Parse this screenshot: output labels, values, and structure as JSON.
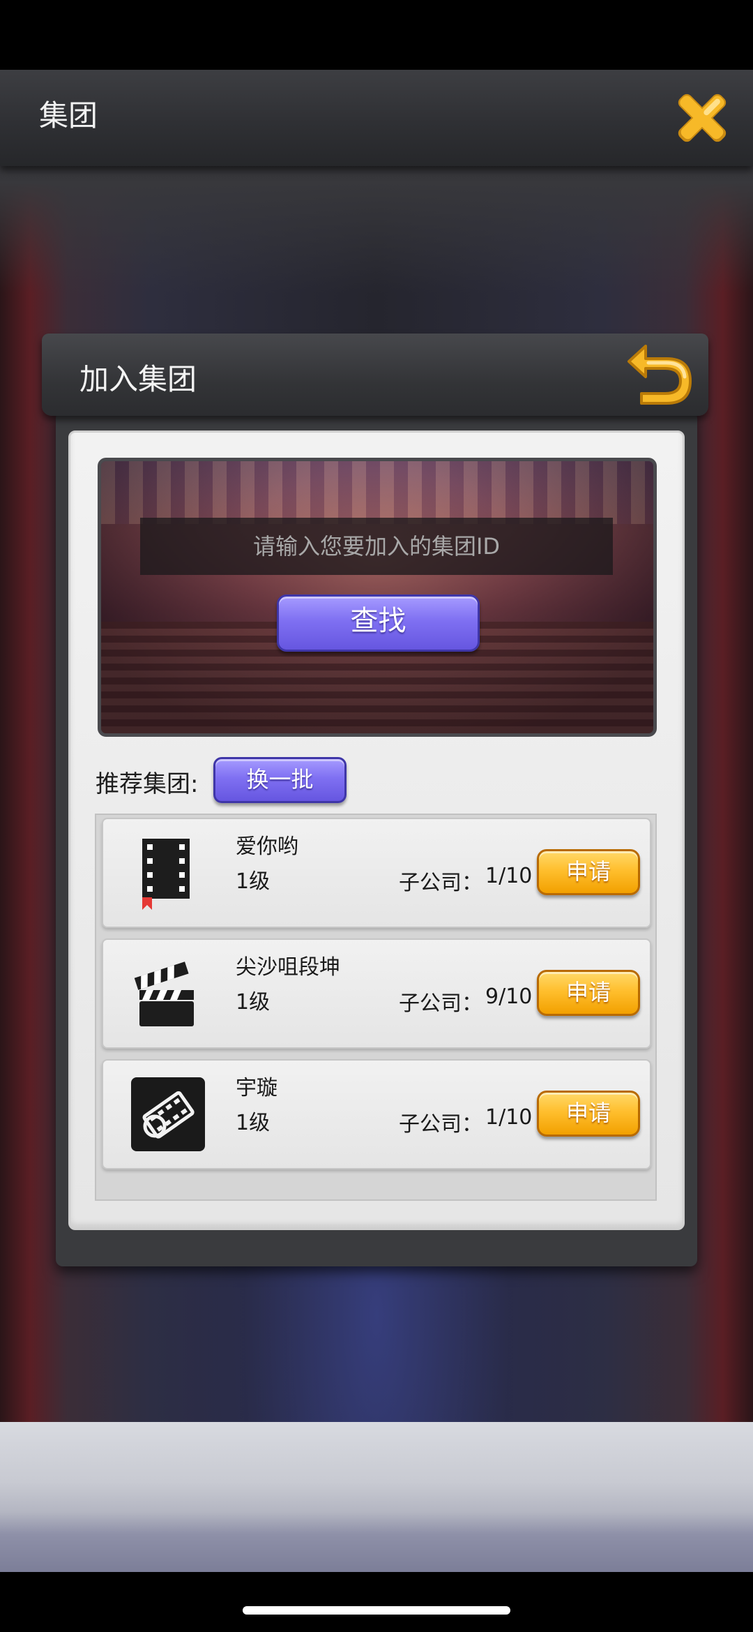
{
  "header": {
    "title": "集团",
    "close_icon": "close-x-icon"
  },
  "modal": {
    "title": "加入集团",
    "back_icon": "back-arrow-icon",
    "search": {
      "placeholder": "请输入您要加入的集团ID",
      "button_label": "查找"
    },
    "recommended": {
      "label": "推荐集团:",
      "refresh_label": "换一批"
    },
    "groups": [
      {
        "icon": "film-strip-icon",
        "name": "爱你哟",
        "level": "1级",
        "sub_label": "子公司：",
        "sub_count": "1/10",
        "apply_label": "申请"
      },
      {
        "icon": "clapperboard-icon",
        "name": "尖沙咀段坤",
        "level": "1级",
        "sub_label": "子公司：",
        "sub_count": "9/10",
        "apply_label": "申请"
      },
      {
        "icon": "film-reel-icon",
        "name": "宇璇",
        "level": "1级",
        "sub_label": "子公司：",
        "sub_count": "1/10",
        "apply_label": "申请"
      }
    ]
  },
  "colors": {
    "accent_purple": "#7f70f2",
    "accent_orange": "#ffbf2e",
    "icon_gold": "#f7b928"
  }
}
